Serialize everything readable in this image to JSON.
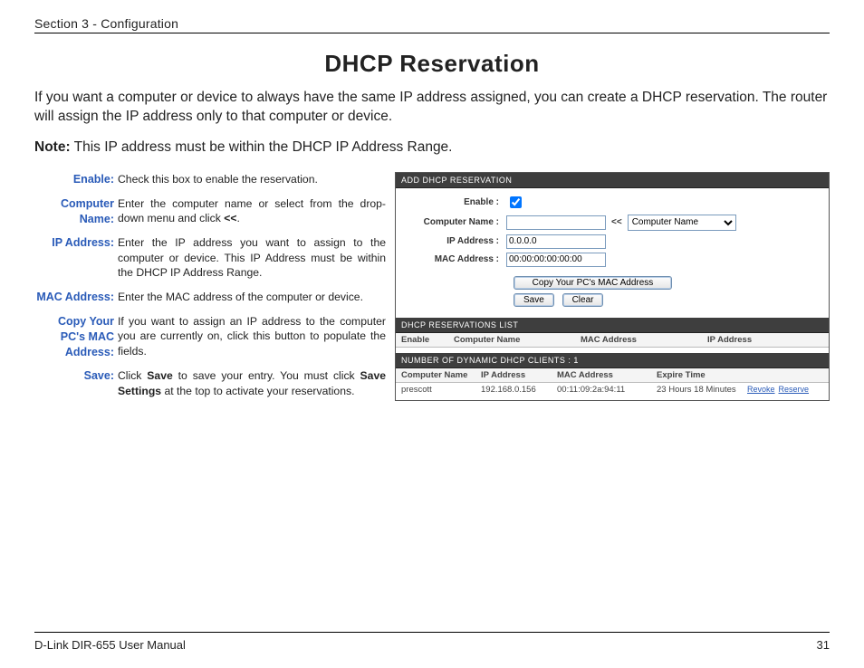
{
  "header": {
    "section": "Section 3 - Configuration"
  },
  "title": "DHCP Reservation",
  "intro": "If you want a computer or device to always have the same IP address assigned, you can create a DHCP reservation. The router will assign the IP address only to that computer or device.",
  "note_label": "Note:",
  "note_text": " This IP address must be within the DHCP IP Address Range.",
  "definitions": [
    {
      "label": "Enable:",
      "body_plain": "Check this box to enable the reservation."
    },
    {
      "label": "Computer Name:",
      "body_html": "Enter the computer name or select from the drop-down menu and click <b>&lt;&lt;</b>."
    },
    {
      "label": "IP Address:",
      "body_plain": "Enter the IP address you want to assign to the computer or device. This IP Address must be within the DHCP IP Address Range."
    },
    {
      "label": "MAC Address:",
      "body_plain": "Enter the MAC address of the computer or device."
    },
    {
      "label": "Copy Your PC's MAC Address:",
      "body_plain": "If you want to assign an IP address to the computer you are currently on, click this button to populate the fields."
    },
    {
      "label": "Save:",
      "body_html": "Click <b>Save</b> to save your entry. You must click <b>Save Settings</b> at the top to activate your reservations."
    }
  ],
  "ui": {
    "add_title": "ADD DHCP RESERVATION",
    "labels": {
      "enable": "Enable :",
      "computer_name": "Computer Name :",
      "ip_address": "IP Address :",
      "mac_address": "MAC Address :",
      "arrows": "<<"
    },
    "values": {
      "computer_name": "",
      "ip": "0.0.0.0",
      "mac": "00:00:00:00:00:00",
      "dropdown": "Computer Name"
    },
    "buttons": {
      "copy_mac": "Copy Your PC's MAC Address",
      "save": "Save",
      "clear": "Clear"
    },
    "reservations_title": "DHCP RESERVATIONS LIST",
    "reservations_columns": [
      "Enable",
      "Computer Name",
      "MAC Address",
      "IP Address"
    ],
    "clients_title": "NUMBER OF DYNAMIC DHCP CLIENTS : 1",
    "clients_columns": [
      "Computer Name",
      "IP Address",
      "MAC Address",
      "Expire Time",
      ""
    ],
    "clients_row": {
      "name": "prescott",
      "ip": "192.168.0.156",
      "mac": "00:11:09:2a:94:11",
      "expire": "23 Hours 18 Minutes",
      "revoke": "Revoke",
      "reserve": "Reserve"
    }
  },
  "footer": {
    "left": "D-Link DIR-655 User Manual",
    "page": "31"
  }
}
